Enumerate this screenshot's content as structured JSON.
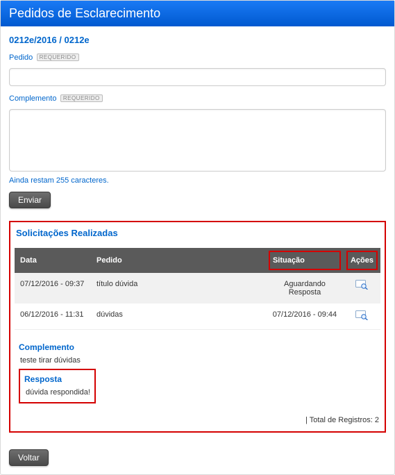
{
  "header": {
    "title": "Pedidos de Esclarecimento"
  },
  "breadcrumb": "0212e/2016 / 0212e",
  "form": {
    "pedido_label": "Pedido",
    "pedido_value": "",
    "complemento_label": "Complemento",
    "complemento_value": "",
    "required_badge": "REQUERIDO",
    "chars_note": "Ainda restam 255 caracteres.",
    "enviar_label": "Enviar"
  },
  "list": {
    "title": "Solicitações Realizadas",
    "columns": {
      "data": "Data",
      "pedido": "Pedido",
      "situacao": "Situação",
      "acoes": "Ações"
    },
    "rows": [
      {
        "data": "07/12/2016 - 09:37",
        "pedido": "título dúvida",
        "situacao": "Aguardando Resposta",
        "expanded": false
      },
      {
        "data": "06/12/2016 - 11:31",
        "pedido": "dúvidas",
        "situacao": "07/12/2016 - 09:44",
        "expanded": true,
        "complemento_label": "Complemento",
        "complemento_text": "teste tirar dúvidas",
        "resposta_label": "Resposta",
        "resposta_text": "dúvida respondida!"
      }
    ],
    "totals_label": "| Total de Registros:",
    "totals_count": "2"
  },
  "footer": {
    "voltar_label": "Voltar"
  }
}
